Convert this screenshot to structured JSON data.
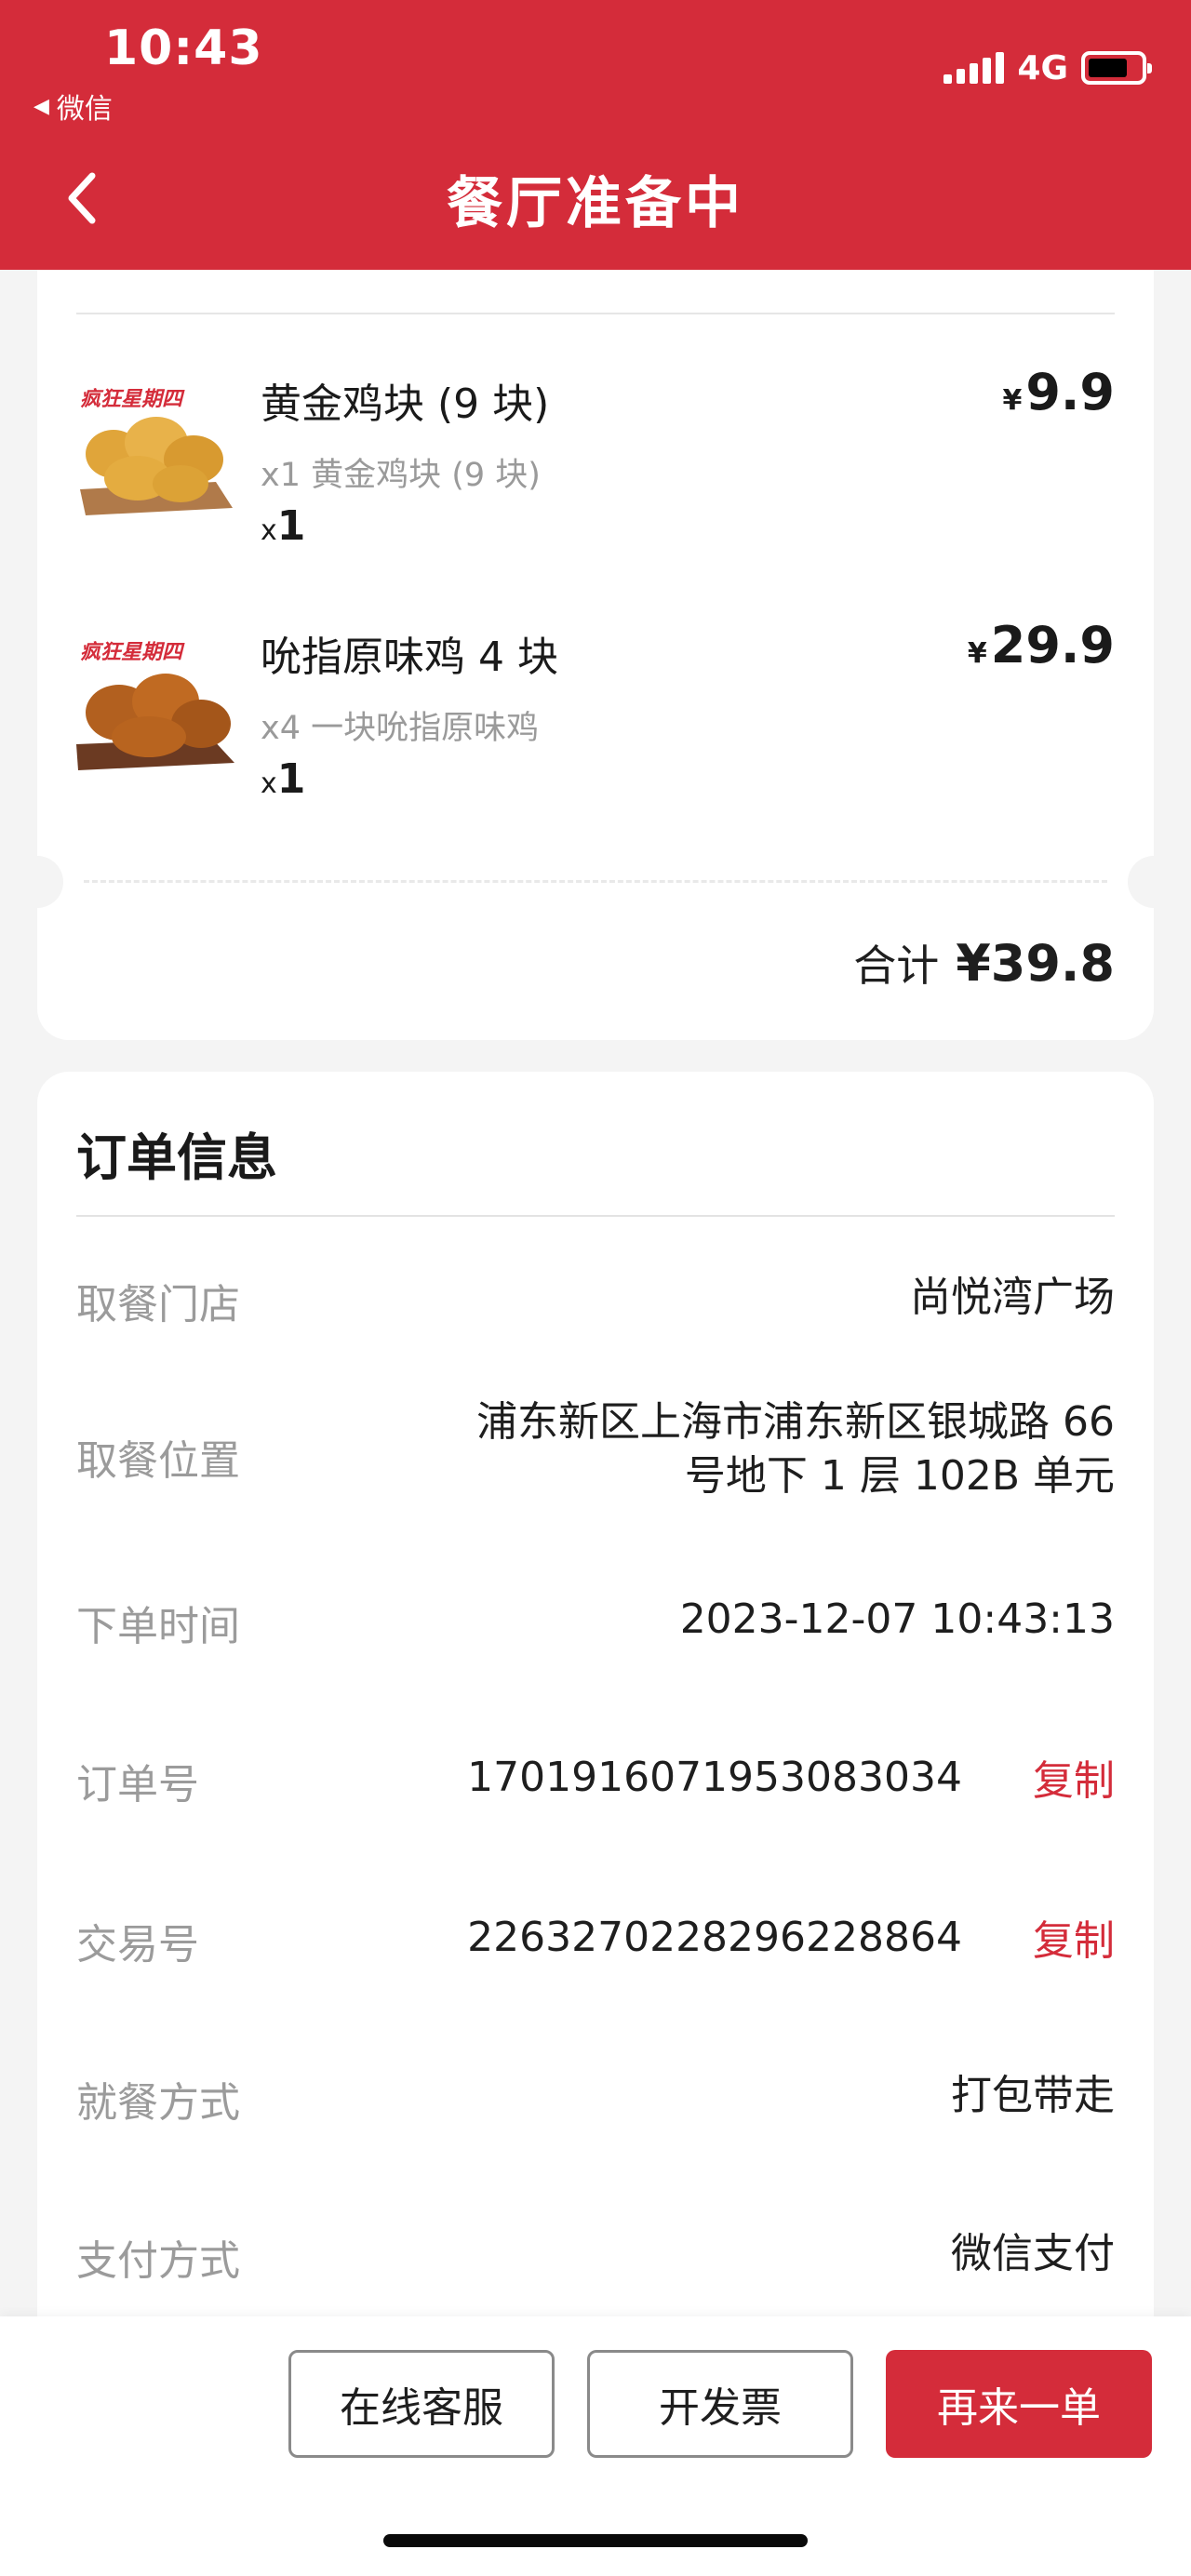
{
  "status_bar": {
    "time": "10:43",
    "back_app": "微信",
    "network": "4G",
    "battery_level": 0.75
  },
  "nav": {
    "title": "餐厅准备中"
  },
  "order_items": [
    {
      "name": "黄金鸡块 (9 块)",
      "detail": "x1 黄金鸡块 (9 块)",
      "qty_prefix": "x",
      "qty": "1",
      "currency": "¥",
      "price": "9.9",
      "image_badge": "疯狂星期四"
    },
    {
      "name": "吮指原味鸡 4 块",
      "detail": "x4 一块吮指原味鸡",
      "qty_prefix": "x",
      "qty": "1",
      "currency": "¥",
      "price": "29.9",
      "image_badge": "疯狂星期四"
    }
  ],
  "total": {
    "label": "合计",
    "amount": "¥39.8"
  },
  "order_info": {
    "title": "订单信息",
    "rows": [
      {
        "label": "取餐门店",
        "value": "尚悦湾广场"
      },
      {
        "label": "取餐位置",
        "value_line1": "浦东新区上海市浦东新区银城路 66",
        "value_line2": "号地下 1 层 102B 单元"
      },
      {
        "label": "下单时间",
        "value": "2023-12-07 10:43:13"
      },
      {
        "label": "订单号",
        "value": "1701916071953083034",
        "action": "复制"
      },
      {
        "label": "交易号",
        "value": "2263270228296228864",
        "action": "复制"
      },
      {
        "label": "就餐方式",
        "value": "打包带走"
      },
      {
        "label": "支付方式",
        "value": "微信支付"
      }
    ]
  },
  "bottom_bar": {
    "customer_service": "在线客服",
    "invoice": "开发票",
    "reorder": "再来一单"
  },
  "colors": {
    "brand_red": "#d42c3a",
    "background": "#f4f4f4"
  }
}
